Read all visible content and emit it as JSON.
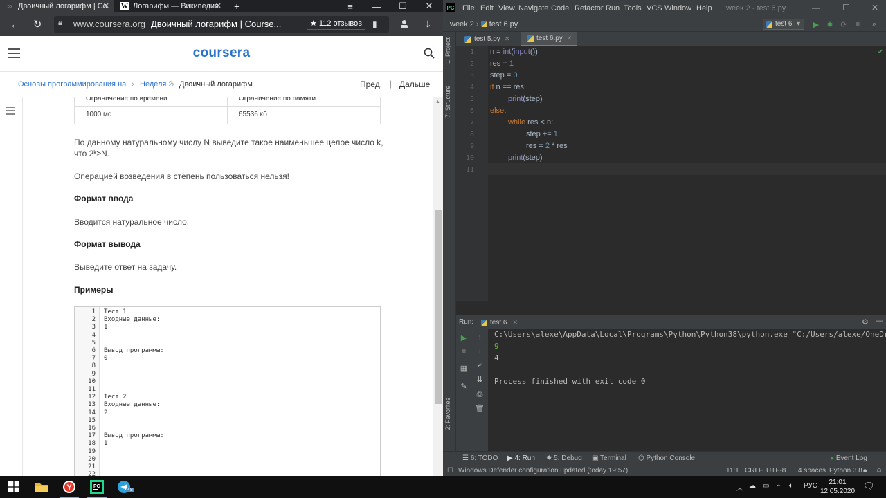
{
  "browser": {
    "tabs": [
      {
        "label": "Двоичный логарифм | Co",
        "icon": "coursera-infinity-icon"
      },
      {
        "label": "Логарифм — Википедия",
        "icon": "wikipedia-w-icon"
      }
    ],
    "new_tab_icon": "+",
    "url_domain": "www.coursera.org",
    "url_title": "Двоичный логарифм | Course...",
    "reviews": "★ 112 отзывов"
  },
  "coursera": {
    "logo": "coursera",
    "breadcrumb": {
      "course": "Основы программирования на Pyth",
      "week": "Неделя 2",
      "current": "Двоичный логарифм",
      "prev": "Пред.",
      "divider": "|",
      "next": "Дальше"
    },
    "limits": {
      "header": [
        "Ограничение по времени",
        "Ограничение по памяти"
      ],
      "values": [
        "1000 мс",
        "65536 кб"
      ]
    },
    "problem": {
      "statement": "По данному натуральному числу N выведите такое наименьшее целое число k, что 2ᵏ≥N.",
      "note": "Операцией возведения в степень пользоваться нельзя!",
      "input_title": "Формат ввода",
      "input_text": "Вводится натуральное число.",
      "output_title": "Формат вывода",
      "output_text": "Выведите ответ на задачу.",
      "examples_title": "Примеры"
    },
    "examples": [
      {
        "n": "1",
        "t": "Тест 1"
      },
      {
        "n": "2",
        "t": "Входные данные:"
      },
      {
        "n": "3",
        "t": "1"
      },
      {
        "n": "4",
        "t": ""
      },
      {
        "n": "5",
        "t": ""
      },
      {
        "n": "6",
        "t": "Вывод программы:"
      },
      {
        "n": "7",
        "t": "0"
      },
      {
        "n": "8",
        "t": ""
      },
      {
        "n": "9",
        "t": ""
      },
      {
        "n": "10",
        "t": ""
      },
      {
        "n": "11",
        "t": ""
      },
      {
        "n": "12",
        "t": "Тест 2"
      },
      {
        "n": "13",
        "t": "Входные данные:"
      },
      {
        "n": "14",
        "t": "2"
      },
      {
        "n": "15",
        "t": ""
      },
      {
        "n": "16",
        "t": ""
      },
      {
        "n": "17",
        "t": "Вывод программы:"
      },
      {
        "n": "18",
        "t": "1"
      },
      {
        "n": "19",
        "t": ""
      },
      {
        "n": "20",
        "t": ""
      },
      {
        "n": "21",
        "t": ""
      },
      {
        "n": "22",
        "t": ""
      }
    ]
  },
  "ide": {
    "logo": "PC",
    "menu": [
      "File",
      "Edit",
      "View",
      "Navigate",
      "Code",
      "Refactor",
      "Run",
      "Tools",
      "VCS",
      "Window",
      "Help"
    ],
    "window_title": "week 2 - test 6.py",
    "project": "week 2",
    "breadcrumb_file": "test 6.py",
    "run_config": "test 6",
    "tabs": [
      "test 5.py",
      "test 6.py"
    ],
    "left_strip": [
      "1: Project",
      "7: Structure",
      "2: Favorites"
    ],
    "code_lines": [
      {
        "n": "1",
        "indent": 0,
        "html": "n = <span class=\"fn\">int</span>(<span class=\"fn\">input</span>())"
      },
      {
        "n": "2",
        "indent": 0,
        "html": "res = <span class=\"num\">1</span>"
      },
      {
        "n": "3",
        "indent": 0,
        "html": "step = <span class=\"num\">0</span>"
      },
      {
        "n": "4",
        "indent": 0,
        "html": "<span class=\"kw\">if</span> n == res:"
      },
      {
        "n": "5",
        "indent": 1,
        "html": "<span class=\"fn\">print</span>(step)"
      },
      {
        "n": "6",
        "indent": 0,
        "html": "<span class=\"kw\">else</span>:"
      },
      {
        "n": "7",
        "indent": 1,
        "html": "<span class=\"kw\">while</span> res &lt; n:"
      },
      {
        "n": "8",
        "indent": 2,
        "html": "step += <span class=\"num\">1</span>"
      },
      {
        "n": "9",
        "indent": 2,
        "html": "res = <span class=\"num\">2</span> * res"
      },
      {
        "n": "10",
        "indent": 1,
        "html": "<span class=\"fn\">print</span>(step)"
      },
      {
        "n": "11",
        "indent": 0,
        "html": ""
      }
    ],
    "run": {
      "label": "Run:",
      "tab": "test 6",
      "console": [
        {
          "text": "C:\\Users\\alexe\\AppData\\Local\\Programs\\Python\\Python38\\python.exe \"C:/Users/alexe/OneDrive",
          "color": "#bbbbbb"
        },
        {
          "text": "9",
          "color": "#62b543"
        },
        {
          "text": "4",
          "color": "#bbbbbb"
        },
        {
          "text": "",
          "color": "#bbbbbb"
        },
        {
          "text": "Process finished with exit code 0",
          "color": "#bbbbbb"
        }
      ]
    },
    "bottom_tabs": [
      "6: TODO",
      "4: Run",
      "5: Debug",
      "Terminal",
      "Python Console"
    ],
    "event_log": "Event Log",
    "status": {
      "message": "Windows Defender configuration updated (today 19:57)",
      "position": "11:1",
      "line_sep": "CRLF",
      "encoding": "UTF-8",
      "indent": "4 spaces",
      "interpreter": "Python 3.8"
    }
  },
  "taskbar": {
    "lang": "РУС",
    "time": "21:01",
    "date": "12.05.2020",
    "telegram_badge": "48"
  },
  "colors": {
    "coursera_blue": "#2a73cc",
    "ide_keyword": "#cc7832",
    "ide_number": "#6897bb",
    "ide_builtin": "#8888c6",
    "run_green": "#499c54"
  }
}
